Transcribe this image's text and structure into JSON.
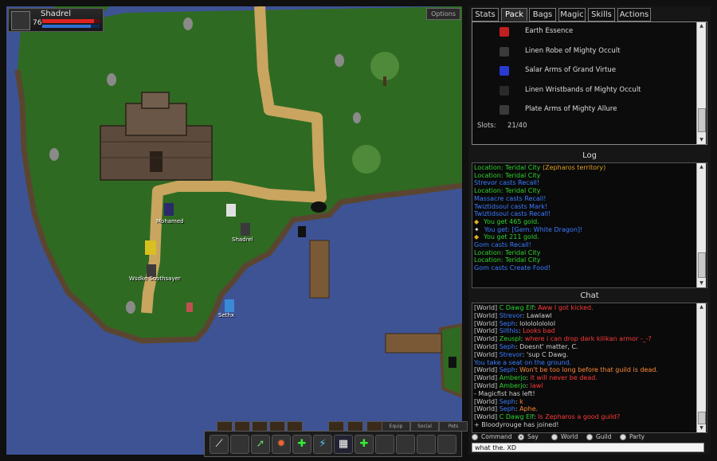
{
  "game_view": {
    "character": {
      "name": "Shadrel",
      "level": "76",
      "hp_fraction": 0.9,
      "mp_fraction": 0.85
    },
    "options_label": "Options",
    "players": [
      {
        "name": "Mohamed"
      },
      {
        "name": "Shadrel"
      },
      {
        "name": "Wsdke Soothsayer"
      },
      {
        "name": "Sethx"
      }
    ],
    "bottom_tabs": [
      "Equip",
      "Social",
      "Pets"
    ],
    "hotbar": [
      "wand",
      "empty-slot",
      "arrow",
      "fire",
      "heal",
      "lightning",
      "net",
      "heal",
      "empty",
      "empty",
      "empty",
      "empty"
    ]
  },
  "panel": {
    "tabs": [
      "Stats",
      "Pack",
      "Bags",
      "Magic",
      "Skills",
      "Actions"
    ],
    "active_tab": "Pack",
    "pack": {
      "items": [
        {
          "name": "Earth Essence",
          "icon_color": "#c02020"
        },
        {
          "name": "Linen Robe of Mighty Occult",
          "icon_color": "#3a3a3a"
        },
        {
          "name": "Salar Arms of Grand Virtue",
          "icon_color": "#2a3ad0"
        },
        {
          "name": "Linen Wristbands of Mighty Occult",
          "icon_color": "#2a2a2a"
        },
        {
          "name": "Plate Arms of Mighty Allure",
          "icon_color": "#3a3a3a"
        }
      ],
      "slots_label": "Slots:",
      "slots_value": "21/40"
    },
    "log_title": "Log",
    "log": [
      {
        "parts": [
          {
            "t": "Location: Teridal City ",
            "c": "#2ed12e"
          },
          {
            "t": "(Zepharos territory)",
            "c": "#e0a020"
          }
        ]
      },
      {
        "parts": [
          {
            "t": "Location: Teridal City",
            "c": "#2ed12e"
          }
        ]
      },
      {
        "parts": [
          {
            "t": "Strevor casts Recall!",
            "c": "#3a7bff"
          }
        ]
      },
      {
        "parts": [
          {
            "t": "Location: Teridal City",
            "c": "#2ed12e"
          }
        ]
      },
      {
        "parts": [
          {
            "t": "Massacre casts Recall!",
            "c": "#3a7bff"
          }
        ]
      },
      {
        "parts": [
          {
            "t": "Twiztidsoul casts Mark!",
            "c": "#3a7bff"
          }
        ]
      },
      {
        "parts": [
          {
            "t": "Twiztidsoul casts Recall!",
            "c": "#3a7bff"
          }
        ]
      },
      {
        "parts": [
          {
            "t": "You get 465 gold.",
            "c": "#2ed12e"
          }
        ],
        "icon": "gold"
      },
      {
        "parts": [
          {
            "t": "You get: [Gem: White Dragon]!",
            "c": "#3a7bff"
          }
        ],
        "icon": "gem"
      },
      {
        "parts": [
          {
            "t": "You get 211 gold.",
            "c": "#2ed12e"
          }
        ],
        "icon": "gold"
      },
      {
        "parts": [
          {
            "t": "Gom casts Recall!",
            "c": "#3a7bff"
          }
        ]
      },
      {
        "parts": [
          {
            "t": "Location: Teridal City",
            "c": "#2ed12e"
          }
        ]
      },
      {
        "parts": [
          {
            "t": "Location: Teridal City",
            "c": "#2ed12e"
          }
        ]
      },
      {
        "parts": [
          {
            "t": "Gom casts Create Food!",
            "c": "#3a7bff"
          }
        ]
      }
    ],
    "chat_title": "Chat",
    "chat": [
      {
        "parts": [
          {
            "t": "[World] ",
            "c": "#cfcfcf"
          },
          {
            "t": "C Dawg Elf",
            "c": "#2ed12e"
          },
          {
            "t": ": ",
            "c": "#cfcfcf"
          },
          {
            "t": "Aww I got kicked.",
            "c": "#ff3a3a"
          }
        ]
      },
      {
        "parts": [
          {
            "t": "[World] ",
            "c": "#cfcfcf"
          },
          {
            "t": "Strevor",
            "c": "#3a7bff"
          },
          {
            "t": ": Lawlawl",
            "c": "#cfcfcf"
          }
        ]
      },
      {
        "parts": [
          {
            "t": "[World] ",
            "c": "#cfcfcf"
          },
          {
            "t": "Seph",
            "c": "#3a7bff"
          },
          {
            "t": ": lolololololol",
            "c": "#cfcfcf"
          }
        ]
      },
      {
        "parts": [
          {
            "t": "[World] ",
            "c": "#cfcfcf"
          },
          {
            "t": "Silthis",
            "c": "#3a7bff"
          },
          {
            "t": ": ",
            "c": "#cfcfcf"
          },
          {
            "t": "Looks bad",
            "c": "#ff3a3a"
          }
        ]
      },
      {
        "parts": [
          {
            "t": "[World] ",
            "c": "#cfcfcf"
          },
          {
            "t": "Zeuspl",
            "c": "#2ed12e"
          },
          {
            "t": ": ",
            "c": "#cfcfcf"
          },
          {
            "t": "where i can drop dark kilikan armor -_-?",
            "c": "#ff3a3a"
          }
        ]
      },
      {
        "parts": [
          {
            "t": "[World] ",
            "c": "#cfcfcf"
          },
          {
            "t": "Seph",
            "c": "#3a7bff"
          },
          {
            "t": ": Doesnt' matter, C.",
            "c": "#cfcfcf"
          }
        ]
      },
      {
        "parts": [
          {
            "t": "[World] ",
            "c": "#cfcfcf"
          },
          {
            "t": "Strevor",
            "c": "#3a7bff"
          },
          {
            "t": ": 'sup C Dawg.",
            "c": "#cfcfcf"
          }
        ]
      },
      {
        "parts": [
          {
            "t": "You take a seat on the ground.",
            "c": "#3a7bff"
          }
        ]
      },
      {
        "parts": [
          {
            "t": "[World] ",
            "c": "#cfcfcf"
          },
          {
            "t": "Seph",
            "c": "#3a7bff"
          },
          {
            "t": ": ",
            "c": "#cfcfcf"
          },
          {
            "t": "Won't be too long before that guild is dead.",
            "c": "#ff8a3a"
          }
        ]
      },
      {
        "parts": [
          {
            "t": "[World] ",
            "c": "#cfcfcf"
          },
          {
            "t": "Amberjo",
            "c": "#2ed12e"
          },
          {
            "t": ": ",
            "c": "#cfcfcf"
          },
          {
            "t": "it will never be dead.",
            "c": "#ff3a3a"
          }
        ]
      },
      {
        "parts": [
          {
            "t": "[World] ",
            "c": "#cfcfcf"
          },
          {
            "t": "Amberjo",
            "c": "#2ed12e"
          },
          {
            "t": ": ",
            "c": "#cfcfcf"
          },
          {
            "t": "lawl",
            "c": "#ff3a3a"
          }
        ]
      },
      {
        "parts": [
          {
            "t": " - Magicfist has left!",
            "c": "#cfcfcf"
          }
        ]
      },
      {
        "parts": [
          {
            "t": "[World] ",
            "c": "#cfcfcf"
          },
          {
            "t": "Seph",
            "c": "#3a7bff"
          },
          {
            "t": ": ",
            "c": "#cfcfcf"
          },
          {
            "t": "k",
            "c": "#ff8a3a"
          }
        ]
      },
      {
        "parts": [
          {
            "t": "[World] ",
            "c": "#cfcfcf"
          },
          {
            "t": "Seph",
            "c": "#3a7bff"
          },
          {
            "t": ": ",
            "c": "#cfcfcf"
          },
          {
            "t": "Aphe.",
            "c": "#ff8a3a"
          }
        ]
      },
      {
        "parts": [
          {
            "t": "[World] ",
            "c": "#cfcfcf"
          },
          {
            "t": "C Dawg Elf",
            "c": "#2ed12e"
          },
          {
            "t": ": ",
            "c": "#cfcfcf"
          },
          {
            "t": "Is Zepharos a good guild?",
            "c": "#ff3a3a"
          }
        ]
      },
      {
        "parts": [
          {
            "t": " + Bloodyrouge has joined!",
            "c": "#cfcfcf"
          }
        ]
      }
    ],
    "channels": [
      {
        "label": "Command",
        "selected": false
      },
      {
        "label": "Say",
        "selected": true
      },
      {
        "label": "World",
        "selected": false
      },
      {
        "label": "Guild",
        "selected": false
      },
      {
        "label": "Party",
        "selected": false
      }
    ],
    "chat_input_value": "what the. XD"
  }
}
